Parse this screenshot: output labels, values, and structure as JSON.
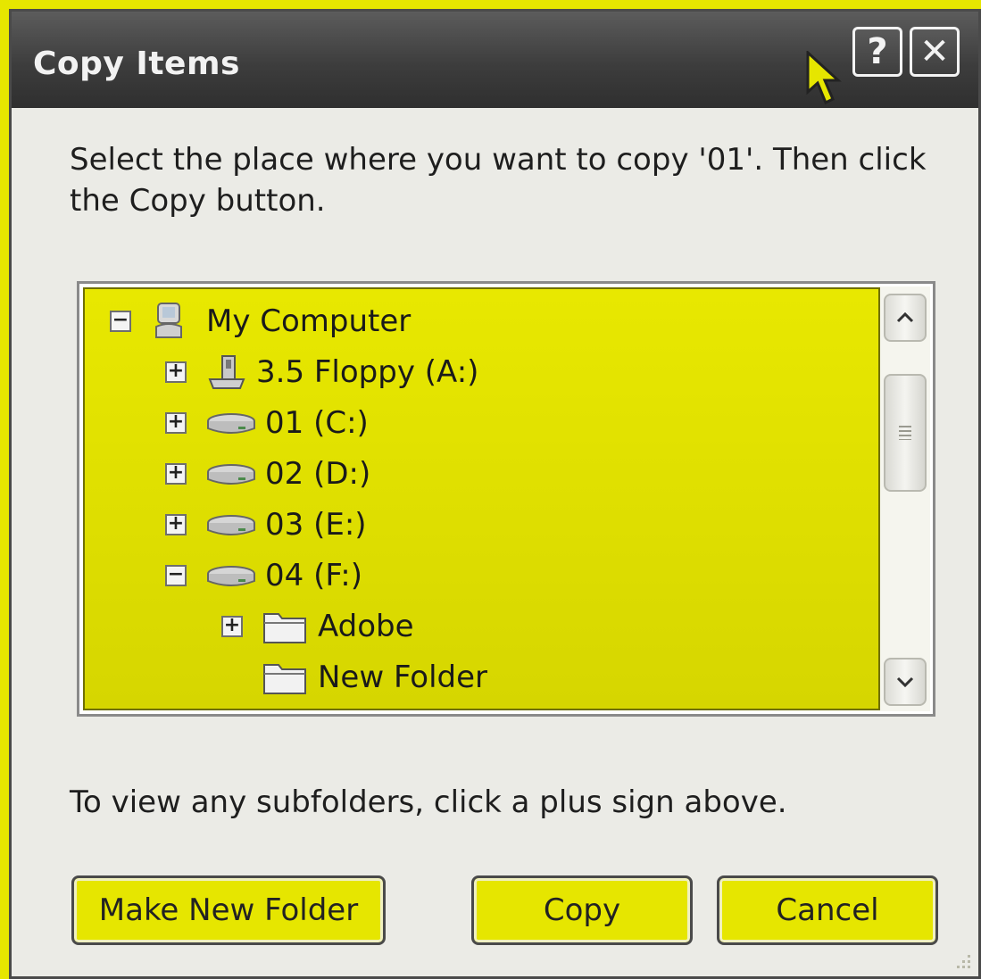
{
  "window": {
    "title": "Copy Items",
    "help_label": "?",
    "close_label": "✕"
  },
  "prompt": "Select the place where you want to copy '01'. Then click the Copy button.",
  "tree": {
    "items": [
      {
        "label": "My Computer",
        "expander": "−",
        "icon": "computer-icon"
      },
      {
        "label": "3.5 Floppy (A:)",
        "expander": "+",
        "icon": "floppy-drive-icon"
      },
      {
        "label": "01 (C:)",
        "expander": "+",
        "icon": "hard-drive-icon"
      },
      {
        "label": "02 (D:)",
        "expander": "+",
        "icon": "hard-drive-icon"
      },
      {
        "label": "03 (E:)",
        "expander": "+",
        "icon": "hard-drive-icon"
      },
      {
        "label": "04 (F:)",
        "expander": "−",
        "icon": "hard-drive-icon"
      },
      {
        "label": "Adobe",
        "expander": "+",
        "icon": "folder-icon"
      },
      {
        "label": "New Folder",
        "expander": "",
        "icon": "folder-icon"
      }
    ]
  },
  "hint": "To view any subfolders, click a plus sign above.",
  "buttons": {
    "make_new_folder": "Make New Folder",
    "copy": "Copy",
    "cancel": "Cancel"
  },
  "colors": {
    "highlight": "#e6e600",
    "titlebar": "#3d3d3d",
    "dialog": "#ebebe6"
  }
}
